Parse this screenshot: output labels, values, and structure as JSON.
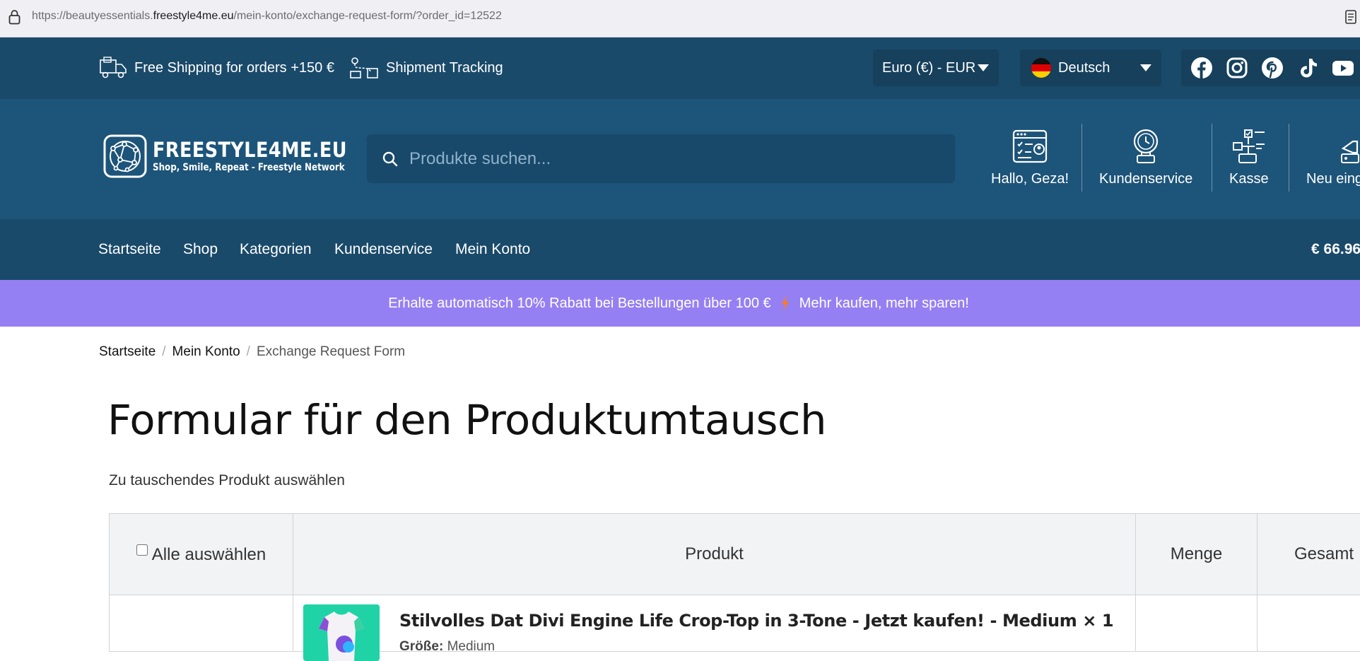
{
  "browser": {
    "url_prefix": "https://beautyessentials.",
    "url_domain": "freestyle4me.eu",
    "url_suffix": "/mein-konto/exchange-request-form/?order_id=12522"
  },
  "topbar": {
    "shipping_text": "Free Shipping for orders +150 €",
    "tracking_text": "Shipment Tracking",
    "currency": "Euro (€) - EUR",
    "language": "Deutsch",
    "socials": [
      "facebook-icon",
      "instagram-icon",
      "pinterest-icon",
      "tiktok-icon",
      "youtube-icon"
    ]
  },
  "header": {
    "brand": "FREESTYLE4ME.EU",
    "tagline": "Shop, Smile, Repeat - Freestyle Network",
    "search_placeholder": "Produkte suchen...",
    "actions": [
      {
        "label": "Hallo, Geza!",
        "icon": "account-icon"
      },
      {
        "label": "Kundenservice",
        "icon": "support-icon"
      },
      {
        "label": "Kasse",
        "icon": "checkout-icon"
      },
      {
        "label": "Neu eing",
        "icon": "new-arrivals-icon"
      }
    ]
  },
  "nav": {
    "items": [
      "Startseite",
      "Shop",
      "Kategorien",
      "Kundenservice",
      "Mein Konto"
    ],
    "cart_total": "€ 66.96"
  },
  "promo": {
    "text_before": "Erhalte automatisch 10% Rabatt bei Bestellungen über 100 €",
    "text_after": "Mehr kaufen, mehr sparen!"
  },
  "breadcrumb": {
    "items": [
      "Startseite",
      "Mein Konto",
      "Exchange Request Form"
    ],
    "separator": "/"
  },
  "page": {
    "title": "Formular für den Produktumtausch",
    "subtitle": "Zu tauschendes Produkt auswählen"
  },
  "table": {
    "headers": {
      "select_all": "Alle auswählen",
      "product": "Produkt",
      "quantity": "Menge",
      "total": "Gesamt"
    },
    "rows": [
      {
        "product_name": "Stilvolles Dat Divi Engine Life Crop-Top in 3-Tone - Jetzt kaufen! - Medium × 1",
        "attr_label": "Größe:",
        "attr_value": "Medium"
      }
    ]
  },
  "colors": {
    "topbar": "#1a4a6a",
    "header": "#1d5479",
    "promo": "#9580f3"
  }
}
